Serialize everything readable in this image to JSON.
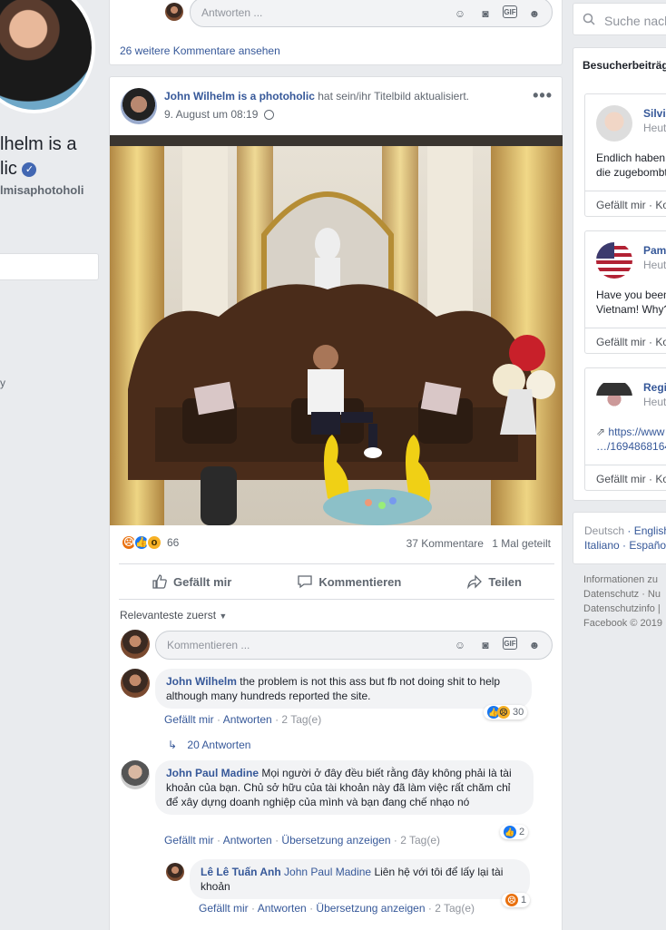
{
  "profile": {
    "name_line1": "lhelm is a",
    "name_line2": "lic",
    "handle": "lmisaphotoholi",
    "tick_mark": "y"
  },
  "top_card": {
    "reply_placeholder": "Antworten ...",
    "more_comments": "26 weitere Kommentare ansehen"
  },
  "post": {
    "author": "John Wilhelm is a photoholic",
    "action": "hat sein/ihr Titelbild aktualisiert.",
    "date": "9. August um 08:19",
    "menu": "•••",
    "reaction_count": "66",
    "comments_count": "37 Kommentare",
    "shares_count": "1 Mal geteilt",
    "actions": {
      "like": "Gefällt mir",
      "comment": "Kommentieren",
      "share": "Teilen"
    },
    "sort_label": "Relevanteste zuerst",
    "comment_placeholder": "Kommentieren ..."
  },
  "comments": [
    {
      "author": "John Wilhelm",
      "text": "the problem is not this ass but fb not doing shit to help although many hundreds reported the site.",
      "like": "Gefällt mir",
      "reply": "Antworten",
      "time": "2 Tag(e)",
      "reactions": "30"
    },
    {
      "replies_label": "20 Antworten"
    },
    {
      "author": "John Paul Madine",
      "text": "Mọi người ở đây đều biết rằng đây không phải là tài khoản của bạn. Chủ sở hữu của tài khoản này đã làm việc rất chăm chỉ để xây dựng doanh nghiệp của mình và bạn đang chế nhạo nó",
      "like": "Gefällt mir",
      "reply": "Antworten",
      "translate": "Übersetzung anzeigen",
      "time": "2 Tag(e)",
      "reactions": "2"
    },
    {
      "author": "Lê Lê Tuấn Anh",
      "mention": "John Paul Madine",
      "text": "Liên hệ với tôi để lấy lại tài khoản",
      "like": "Gefällt mir",
      "reply": "Antworten",
      "translate": "Übersetzung anzeigen",
      "time": "2 Tag(e)",
      "reactions": "1"
    }
  ],
  "right": {
    "search_placeholder": "Suche nach",
    "visitor_title": "Besucherbeiträg",
    "visitor_posts": [
      {
        "name": "Silvi",
        "time": "Heute",
        "text_line1": "Endlich haben",
        "text_line2": "die zugebombt",
        "footer": "Gefällt mir · Ko"
      },
      {
        "name": "Pame",
        "time": "Heute",
        "text_line1": "Have you been",
        "text_line2": "Vietnam! Why?",
        "footer": "Gefällt mir · Ko"
      },
      {
        "name": "Regi",
        "time": "Heute",
        "text_line1": "https://www",
        "text_line2": "…/1694868164",
        "footer": "Gefällt mir · Ko"
      }
    ],
    "languages": {
      "lang1": "Deutsch",
      "lang2": "English",
      "lang3": "Italiano",
      "lang4": "Españo"
    },
    "footer": {
      "line1": "Informationen zu",
      "line2": "Datenschutz · Nu",
      "line3": "Datenschutzinfo |",
      "line4": "Facebook © 2019"
    }
  }
}
